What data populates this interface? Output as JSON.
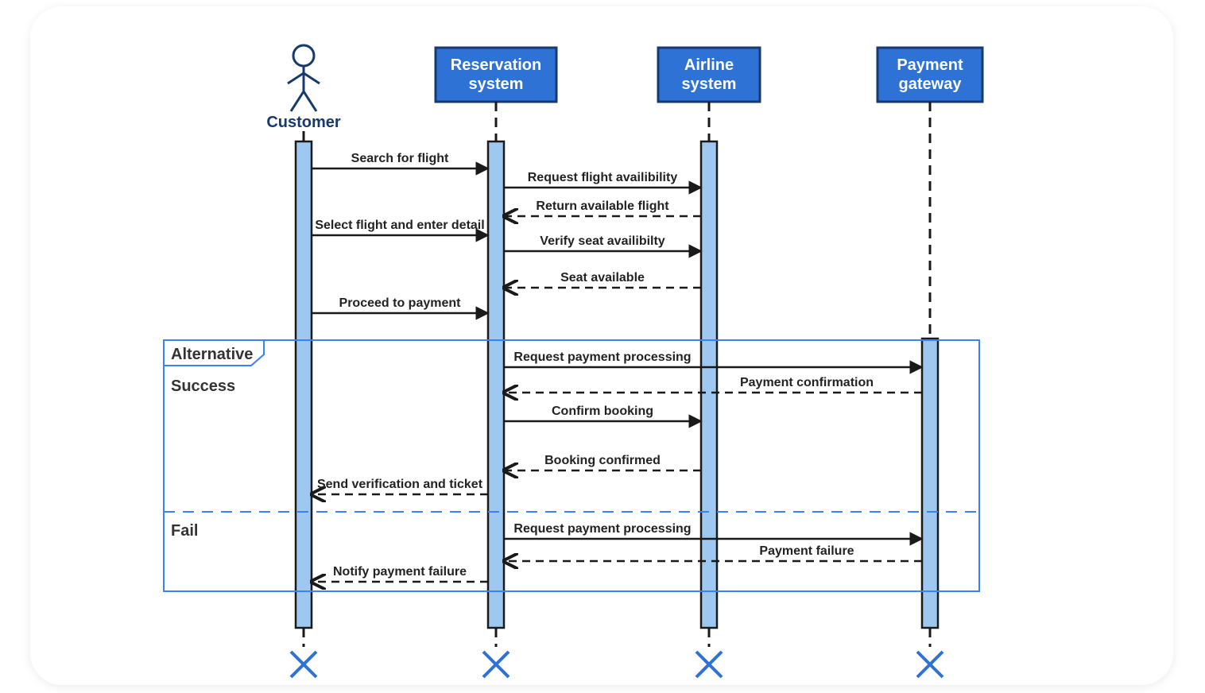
{
  "participants": {
    "customer": "Customer",
    "reservation": "Reservation system",
    "airline": "Airline system",
    "payment": "Payment gateway"
  },
  "alt": {
    "title": "Alternative",
    "success": "Success",
    "fail": "Fail"
  },
  "messages": {
    "m1": "Search for flight",
    "m2": "Request flight availibility",
    "m3": "Return available flight",
    "m4": "Select flight and enter detail",
    "m5": "Verify seat availibilty",
    "m6": "Seat available",
    "m7": "Proceed to payment",
    "m8": "Request payment processing",
    "m9": "Payment confirmation",
    "m10": "Confirm booking",
    "m11": "Booking confirmed",
    "m12": "Send verification and ticket",
    "m13": "Request payment processing",
    "m14": "Payment failure",
    "m15": "Notify payment failure"
  }
}
